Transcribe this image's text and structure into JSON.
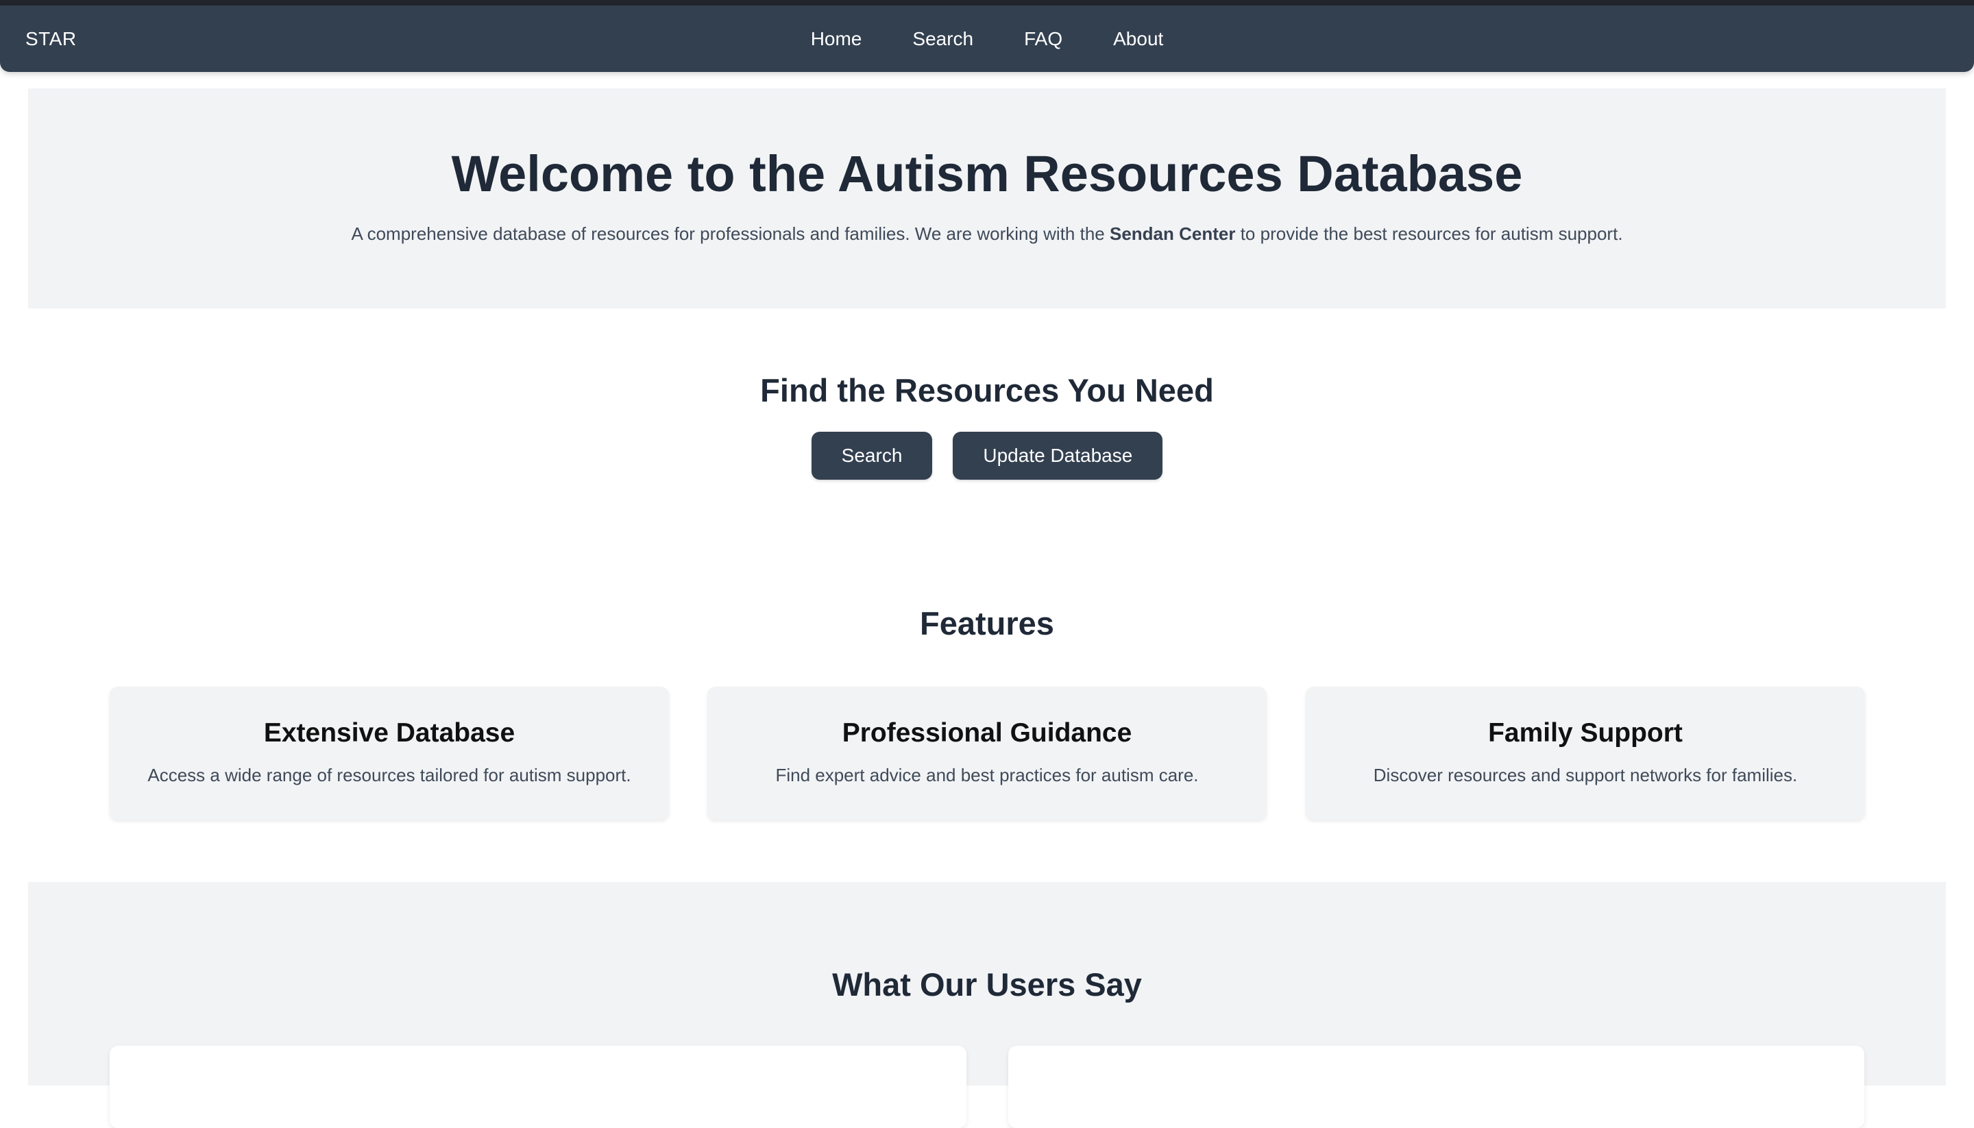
{
  "nav": {
    "brand": "STAR",
    "links": [
      "Home",
      "Search",
      "FAQ",
      "About"
    ]
  },
  "hero": {
    "title": "Welcome to the Autism Resources Database",
    "desc_before": "A comprehensive database of resources for professionals and families. We are working with the ",
    "desc_strong": "Sendan Center",
    "desc_after": " to provide the best resources for autism support."
  },
  "find": {
    "title": "Find the Resources You Need",
    "search_button": "Search",
    "update_button": "Update Database"
  },
  "features": {
    "title": "Features",
    "cards": [
      {
        "title": "Extensive Database",
        "text": "Access a wide range of resources tailored for autism support."
      },
      {
        "title": "Professional Guidance",
        "text": "Find expert advice and best practices for autism care."
      },
      {
        "title": "Family Support",
        "text": "Discover resources and support networks for families."
      }
    ]
  },
  "testimonials": {
    "title": "What Our Users Say"
  },
  "colors": {
    "navbar": "#334050",
    "section_bg": "#f2f3f5",
    "heading": "#1f2937",
    "button_bg": "#334050"
  }
}
